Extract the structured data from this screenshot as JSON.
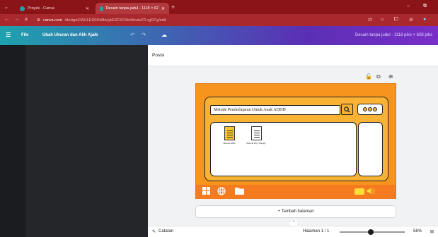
{
  "browser": {
    "tabs": [
      {
        "title": "Proyek - Canva",
        "favicon_color": "#1ea2ae"
      },
      {
        "title": "Desain tanpa judul - 1118 × 62",
        "favicon_color": "#1ea2ae"
      }
    ],
    "new_tab": "+",
    "window_buttons": [
      "–",
      "⧉"
    ],
    "url_domain": "canva.com",
    "url_path": "/design/DAGLED0Dzl8w/ybDZC62Xkh8euIsZD-rgDCg/edit"
  },
  "editor_menu": {
    "menu_label": "☰",
    "file": "File",
    "resize": "Ubah Ukuran dan Alih Ajaib",
    "undo": "↶",
    "redo": "↷",
    "cloud": "☁",
    "doc_info": "Desain tanpa judul - 1118 piks × 628 piks"
  },
  "position_panel": {
    "label": "Posisi"
  },
  "canvas_tools": [
    "🔓",
    "⧉",
    "⊕"
  ],
  "design": {
    "search_text": "Metode Pembelajaran Untuk Anak ADHD",
    "files": [
      {
        "label": "Metode ABA"
      },
      {
        "label": "Metode Play Therapy"
      }
    ]
  },
  "add_page": "+ Tambah halaman",
  "status_bar": {
    "notes": "Catatan",
    "page_indicator": "Halaman 1 / 1",
    "zoom": "56%",
    "zoom_fraction": 0.56
  }
}
